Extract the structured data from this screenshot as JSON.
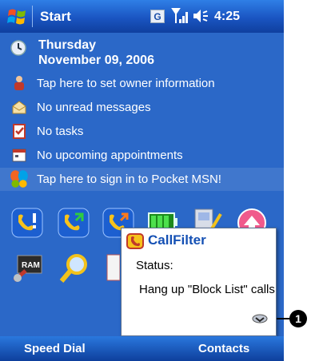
{
  "titlebar": {
    "start_label": "Start",
    "time": "4:25",
    "g_icon_label": "G"
  },
  "date": {
    "weekday": "Thursday",
    "date": "November 09, 2006"
  },
  "today_items": [
    {
      "label": "Tap here to set owner information",
      "icon": "owner-icon"
    },
    {
      "label": "No unread messages",
      "icon": "messages-icon"
    },
    {
      "label": "No tasks",
      "icon": "tasks-icon"
    },
    {
      "label": "No upcoming appointments",
      "icon": "calendar-icon"
    },
    {
      "label": "Tap here to sign in to Pocket MSN!",
      "icon": "msn-butterfly-icon"
    }
  ],
  "program_icons": [
    "phone-alert-icon",
    "phone-incoming-icon",
    "phone-outgoing-icon",
    "battery-icon",
    "settings-icon",
    "up-arrow-icon",
    "ram-chip-icon",
    "search-icon",
    "partial-icon"
  ],
  "popup": {
    "title": "CallFilter",
    "status_label": "Status:",
    "message": "Hang up \"Block List\" calls"
  },
  "callout": {
    "number": "1"
  },
  "softkeys": {
    "left": "Speed Dial",
    "right": "Contacts"
  },
  "colors": {
    "background": "#2b68c8",
    "title_bar": "#1a55c2",
    "popup_title": "#1450b4"
  }
}
